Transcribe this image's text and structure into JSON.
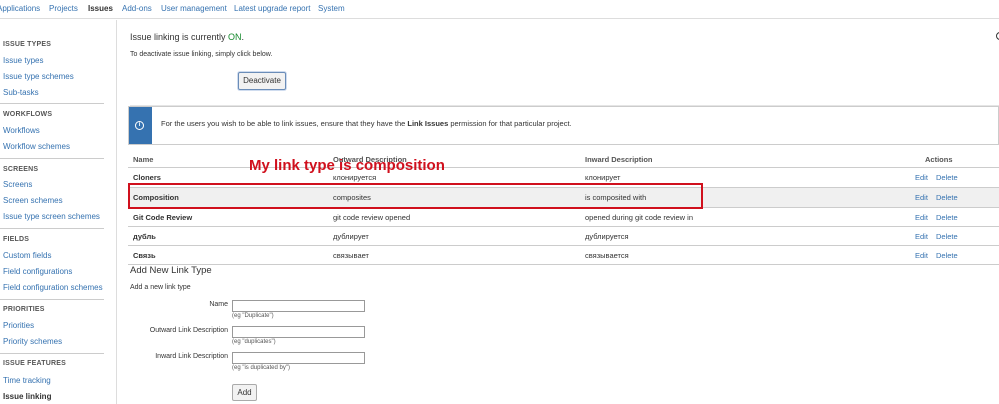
{
  "topnav": {
    "items": [
      "Applications",
      "Projects",
      "Issues",
      "Add-ons",
      "User management",
      "Latest upgrade report",
      "System"
    ],
    "active": "Issues"
  },
  "sidebar": {
    "sections": [
      {
        "heading": "ISSUE TYPES",
        "links": [
          "Issue types",
          "Issue type schemes",
          "Sub-tasks"
        ]
      },
      {
        "heading": "WORKFLOWS",
        "links": [
          "Workflows",
          "Workflow schemes"
        ]
      },
      {
        "heading": "SCREENS",
        "links": [
          "Screens",
          "Screen schemes",
          "Issue type screen schemes"
        ]
      },
      {
        "heading": "FIELDS",
        "links": [
          "Custom fields",
          "Field configurations",
          "Field configuration schemes"
        ]
      },
      {
        "heading": "PRIORITIES",
        "links": [
          "Priorities",
          "Priority schemes"
        ]
      },
      {
        "heading": "ISSUE FEATURES",
        "links": [
          "Time tracking",
          "Issue linking"
        ]
      }
    ],
    "active": "Issue linking"
  },
  "status": {
    "prefix": "Issue linking is currently ",
    "state": "ON",
    "suffix": ".",
    "instruction": "To deactivate issue linking, simply click below.",
    "deactivate_label": "Deactivate"
  },
  "info": {
    "icon": "info-icon",
    "text_before": "For the users you wish to be able to link issues, ensure that they have the ",
    "text_bold": "Link Issues",
    "text_after": " permission for that particular project."
  },
  "table": {
    "headers": {
      "name": "Name",
      "outward": "Outward Description",
      "inward": "Inward Description",
      "actions": "Actions"
    },
    "rows": [
      {
        "name": "Cloners",
        "outward": "клонируется",
        "inward": "клонирует",
        "edit": "Edit",
        "delete": "Delete"
      },
      {
        "name": "Composition",
        "outward": "composites",
        "inward": "is composited with",
        "edit": "Edit",
        "delete": "Delete"
      },
      {
        "name": "Git Code Review",
        "outward": "git code review opened",
        "inward": "opened during git code review in",
        "edit": "Edit",
        "delete": "Delete"
      },
      {
        "name": "дубль",
        "outward": "дублирует",
        "inward": "дублируется",
        "edit": "Edit",
        "delete": "Delete"
      },
      {
        "name": "Связь",
        "outward": "связывает",
        "inward": "связывается",
        "edit": "Edit",
        "delete": "Delete"
      }
    ]
  },
  "annotation": {
    "text": "My link type is composition",
    "color": "#d0101d"
  },
  "add_form": {
    "title": "Add New Link Type",
    "subtitle": "Add a new link type",
    "fields": [
      {
        "label": "Name",
        "value": "",
        "hint": "(eg \"Duplicate\")"
      },
      {
        "label": "Outward Link Description",
        "value": "",
        "hint": "(eg \"duplicates\")"
      },
      {
        "label": "Inward Link Description",
        "value": "",
        "hint": "(eg \"is duplicated by\")"
      }
    ],
    "add_label": "Add"
  },
  "colors": {
    "link": "#3572b0",
    "on": "#14892c",
    "info_bar": "#3572b0",
    "highlight_row": "#f0f0f0"
  }
}
